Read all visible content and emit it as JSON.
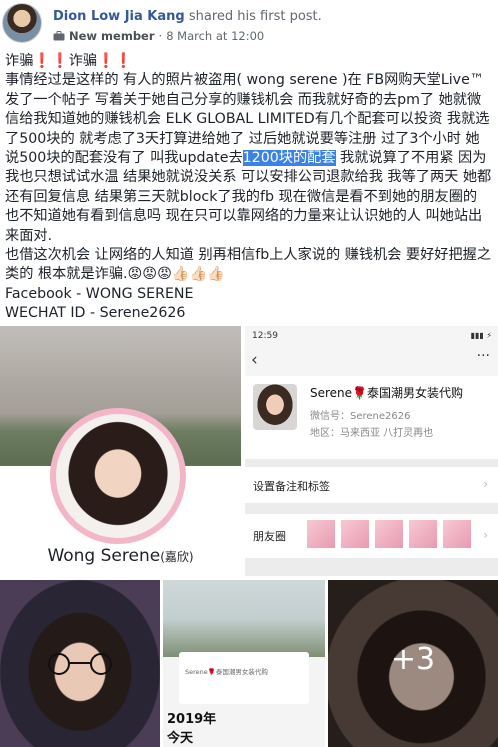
{
  "post": {
    "author": "Dion Low Jia Kang",
    "action": "shared his first post.",
    "badge": "New member",
    "separator": "·",
    "timestamp": "8 March at 12:00",
    "text": {
      "line1": "诈骗❗❗诈骗❗❗",
      "para1_before": "事情经过是这样的 有人的照片被盗用( wong serene )在 FB网购天堂Live™ 发了一个帖子 写着关于她自己分享的赚钱机会 而我就好奇的去pm了 她就微信给我知道她的赚钱机会 ELK GLOBAL LIMITED有几个配套可以投资 我就选了500块的 就考虑了3天打算进给她了 过后她就说要等注册 过了3个小时 她说500块的配套没有了 叫我update去",
      "para1_highlight": "1200块的配套",
      "para1_after": " 我就说算了不用紧 因为我也只想试试水温 结果她就说没关系 可以安排公司退款给我 我等了两天 她都还有回复信息 结果第三天就block了我的fb 现在微信是看不到她的朋友圈的 也不知道她有看到信息吗 现在只可以靠网络的力量来让认识她的人 叫她站出来面对.",
      "para2": "也借这次机会 让网络的人知道 别再相信fb上人家说的 赚钱机会 要好好把握之类的 根本就是诈骗.😡😡😡👍🏻👍🏻👍🏻",
      "facebook_line": "Facebook - WONG SERENE",
      "wechat_line": "WECHAT ID - Serene2626"
    }
  },
  "photos": {
    "profile_card": {
      "name": "Wong Serene",
      "name_suffix": "(嘉欣)"
    },
    "wechat": {
      "time": "12:59",
      "signal": "▮▮▮ ⚡",
      "back": "‹",
      "more": "···",
      "name": "Serene🌹泰国潮男女装代购",
      "id_label": "微信号：Serene2626",
      "region_label": "地区：马来西亚  八打灵再也",
      "row_remark": "设置备注和标签",
      "row_moments": "朋友圈",
      "chevron": "›"
    },
    "collage": {
      "mini_text": "Serene🌹泰国潮男女装代购",
      "year": "2019年",
      "today": "今天"
    },
    "more_count": "+3"
  },
  "colors": {
    "link": "#365899",
    "highlight": "#3b82e6",
    "meta": "#606770"
  }
}
